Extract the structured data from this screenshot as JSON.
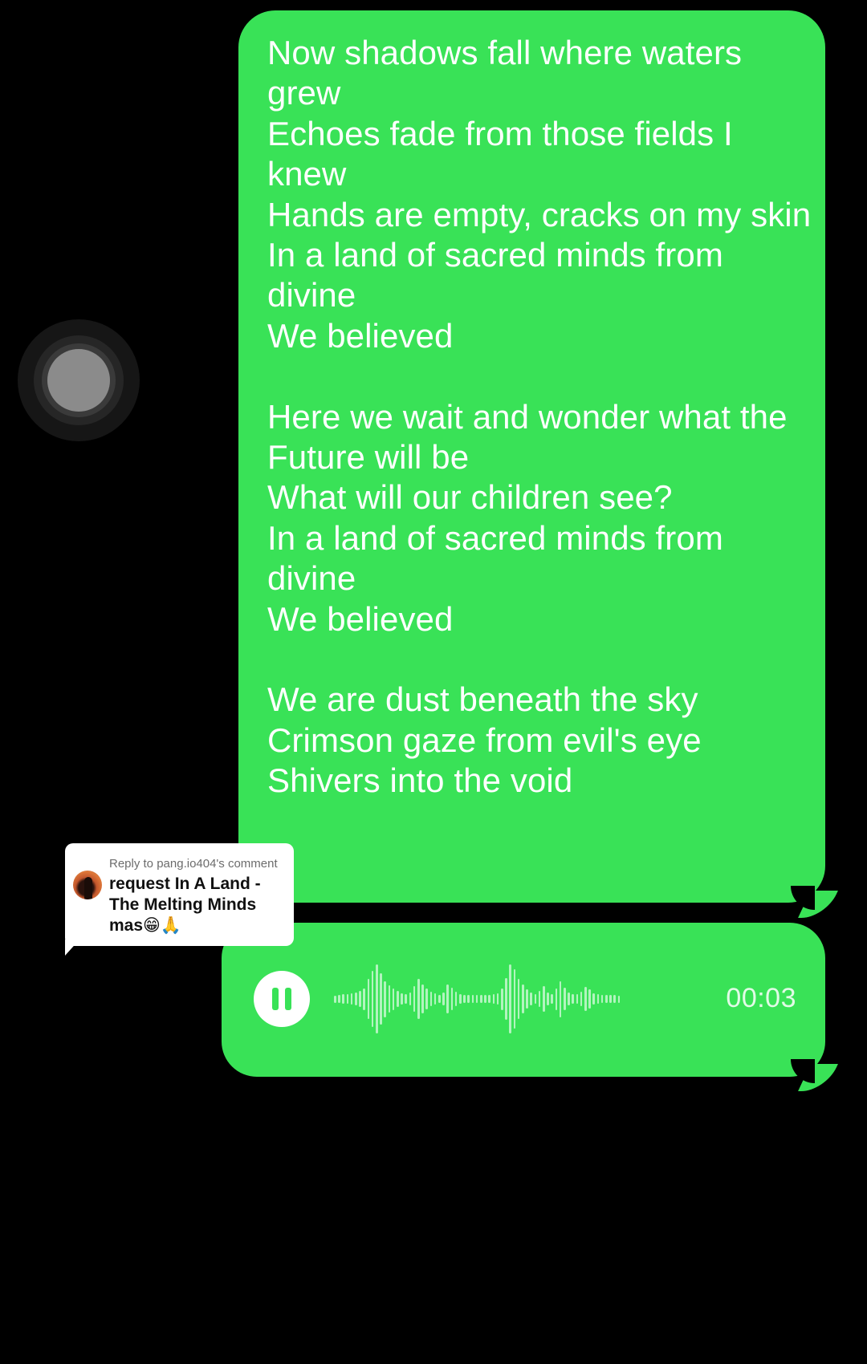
{
  "assistive_touch": {
    "icon": "assistive-touch-icon"
  },
  "lyrics_message": {
    "lines": [
      "Now shadows fall where waters grew",
      "Echoes fade from those fields I knew",
      "Hands are empty, cracks on my skin",
      "In a land of sacred minds from divine",
      "We believed",
      "",
      "Here we wait and wonder what the Future will be",
      "What will our children see?",
      "In a land of sacred minds from divine",
      "We believed",
      "",
      "We are dust beneath the sky",
      "Crimson gaze from evil's eye",
      "Shivers into the void"
    ],
    "bubble_color": "#39e257"
  },
  "voice_message": {
    "state_icon": "pause-icon",
    "duration": "00:03",
    "bubble_color": "#39e257",
    "waveform_levels": [
      0.1,
      0.12,
      0.14,
      0.14,
      0.16,
      0.18,
      0.22,
      0.3,
      0.55,
      0.78,
      0.95,
      0.72,
      0.5,
      0.38,
      0.3,
      0.22,
      0.16,
      0.14,
      0.18,
      0.36,
      0.55,
      0.4,
      0.28,
      0.2,
      0.15,
      0.12,
      0.18,
      0.4,
      0.32,
      0.2,
      0.14,
      0.12,
      0.12,
      0.11,
      0.11,
      0.12,
      0.11,
      0.12,
      0.13,
      0.16,
      0.3,
      0.58,
      0.95,
      0.82,
      0.55,
      0.4,
      0.26,
      0.18,
      0.14,
      0.22,
      0.36,
      0.18,
      0.14,
      0.3,
      0.5,
      0.32,
      0.18,
      0.14,
      0.13,
      0.2,
      0.34,
      0.26,
      0.16,
      0.13,
      0.12,
      0.11,
      0.11,
      0.11,
      0.1
    ]
  },
  "reply_comment": {
    "header": "Reply to pang.io404's comment",
    "text": "request In A Land - The Melting Minds mas😁🙏",
    "avatar": "user-avatar"
  }
}
